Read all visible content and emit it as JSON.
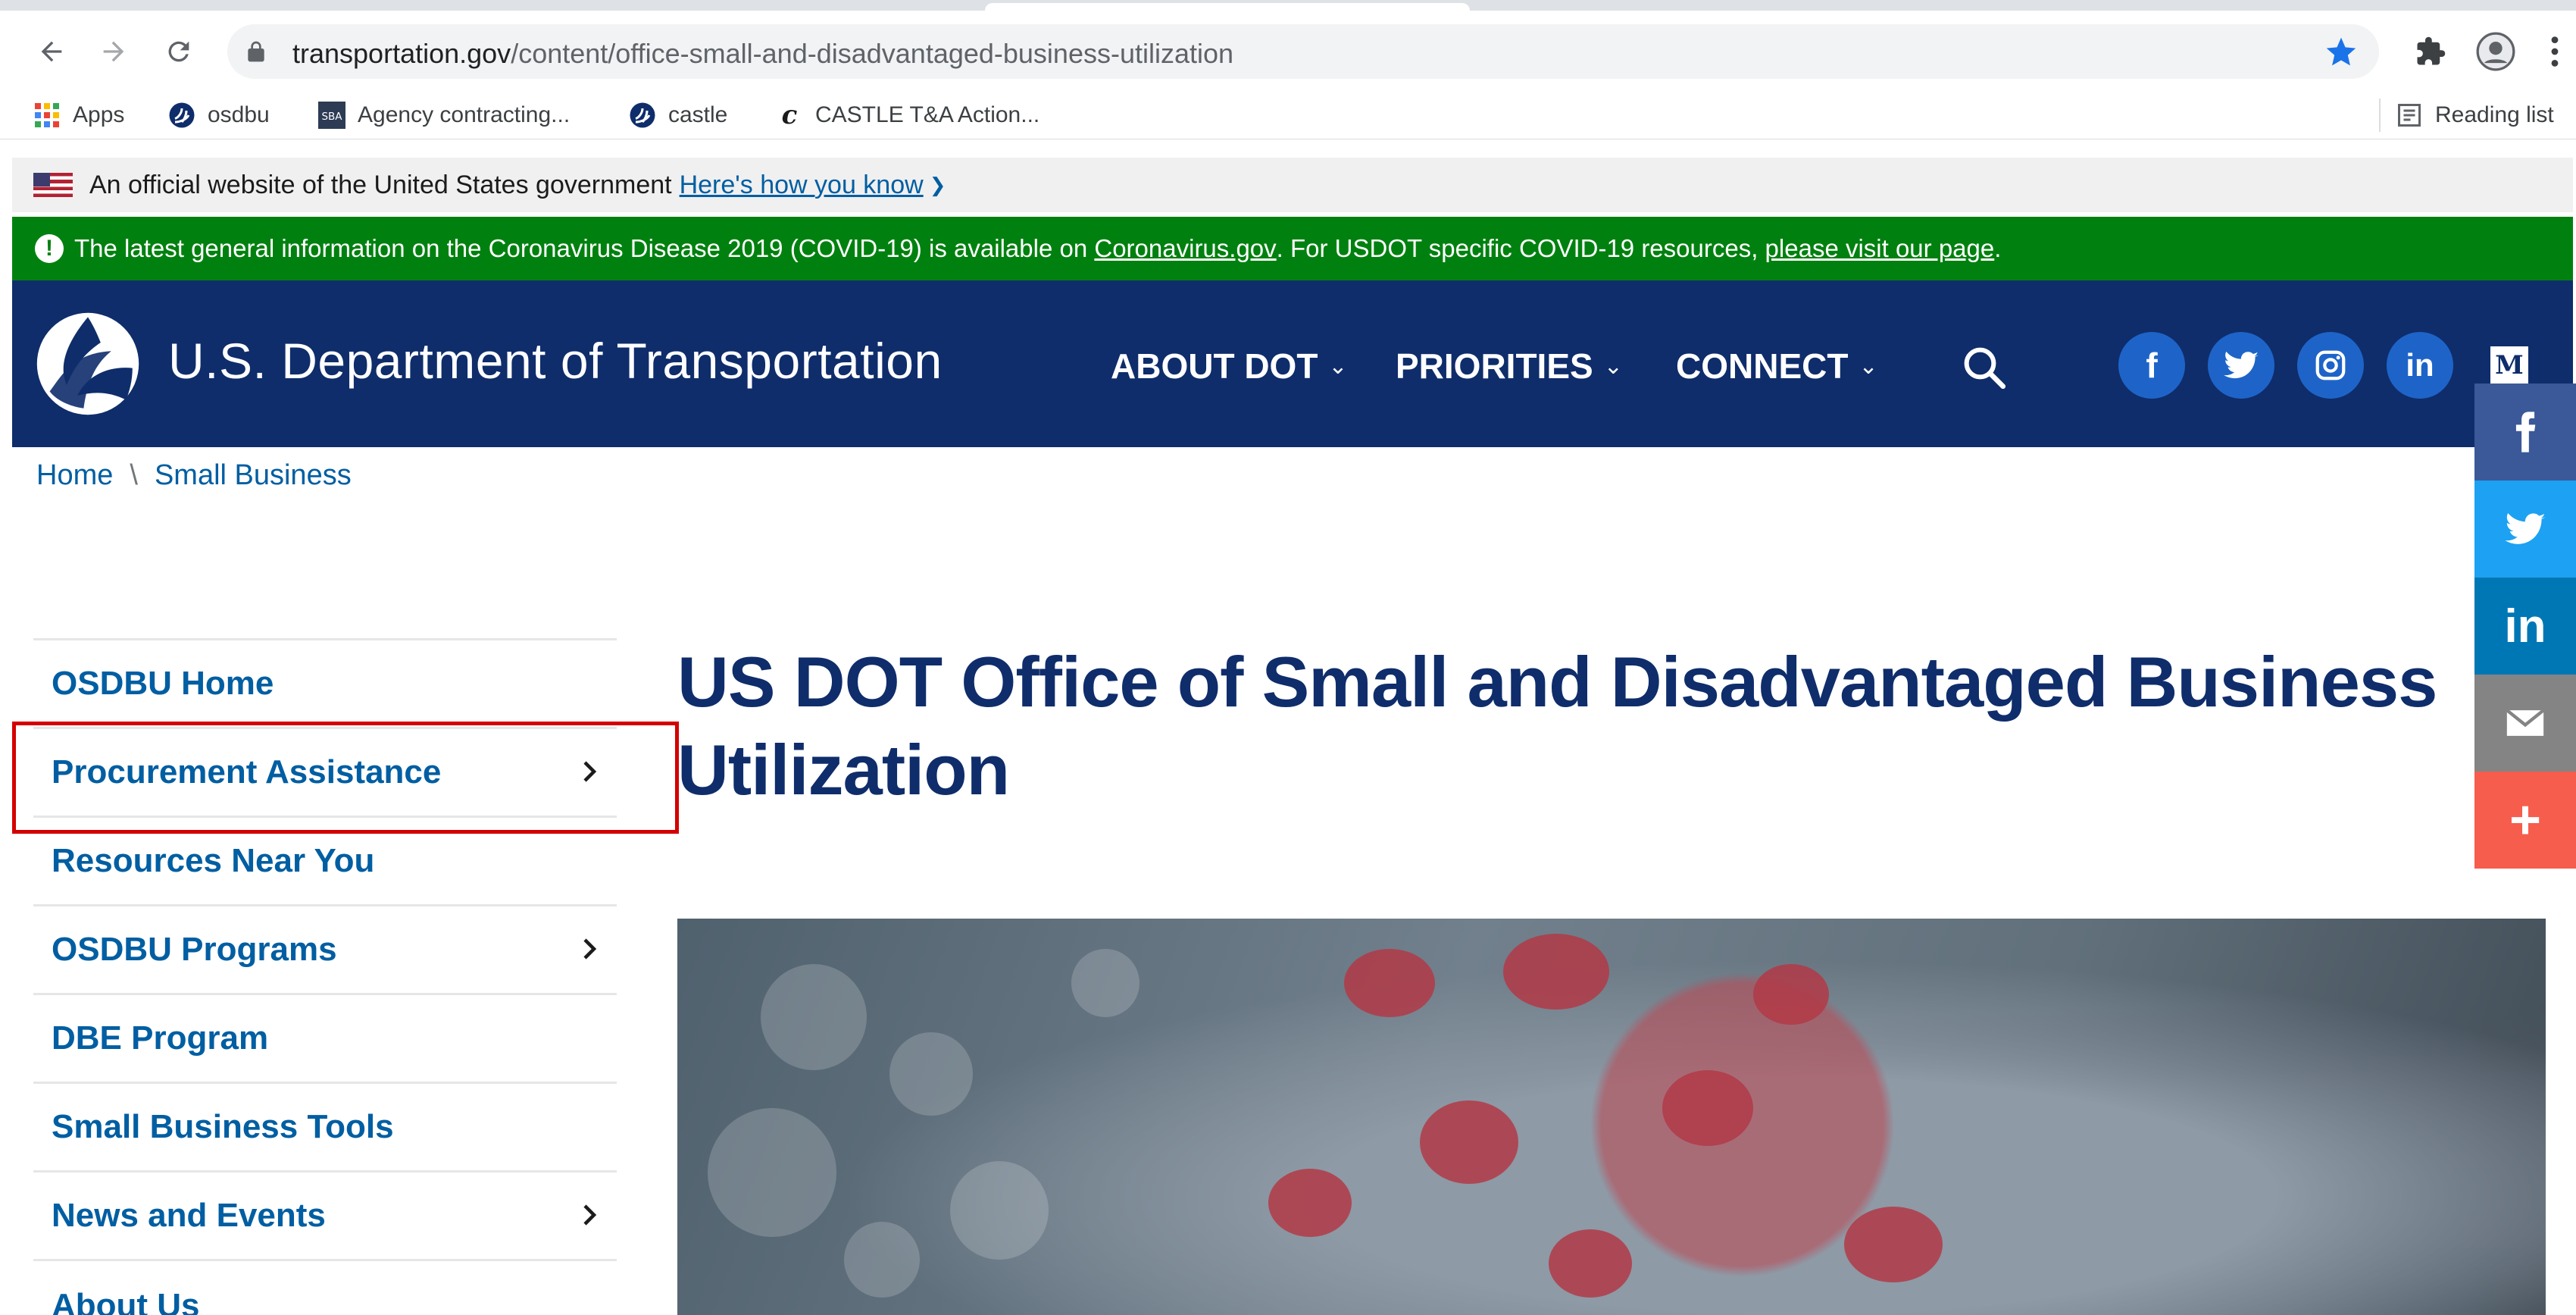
{
  "browser": {
    "url_host": "transportation.gov",
    "url_path": "/content/office-small-and-disadvantaged-business-utilization",
    "bookmarks": [
      {
        "label": "Apps",
        "icon": "apps-grid-icon"
      },
      {
        "label": "osdbu",
        "icon": "dot-logo-icon"
      },
      {
        "label": "Agency contracting...",
        "icon": "sba-icon"
      },
      {
        "label": "castle",
        "icon": "dot-logo-icon"
      },
      {
        "label": "CASTLE T&A Action...",
        "icon": "castle-c-icon"
      }
    ],
    "reading_list": "Reading list"
  },
  "gov_banner": {
    "text": "An official website of the United States government",
    "link": "Here's how you know"
  },
  "alert": {
    "text_1": "The latest general information on the Coronavirus Disease 2019 (COVID-19) is available on",
    "link_1": "Coronavirus.gov",
    "text_2": ". For USDOT specific COVID-19 resources,",
    "link_2": "please visit our page",
    "text_3": "."
  },
  "header": {
    "site_name": "U.S. Department of Transportation",
    "nav": [
      "ABOUT DOT",
      "PRIORITIES",
      "CONNECT"
    ],
    "social": {
      "facebook": "f",
      "twitter": "twitter-bird-icon",
      "instagram": "instagram-icon",
      "linkedin": "in",
      "medium": "M"
    }
  },
  "share_bar": {
    "colors": {
      "facebook": "#3b5998",
      "twitter": "#1da1f2",
      "linkedin": "#0077b5",
      "email": "#848484",
      "more": "#f65d4d"
    },
    "linkedin_label": "in",
    "more_label": "+"
  },
  "breadcrumb": [
    "Home",
    "Small Business"
  ],
  "sidenav": {
    "items": [
      {
        "label": "OSDBU Home",
        "has_submenu": false
      },
      {
        "label": "Procurement Assistance",
        "has_submenu": true
      },
      {
        "label": "Resources Near You",
        "has_submenu": false
      },
      {
        "label": "OSDBU Programs",
        "has_submenu": true
      },
      {
        "label": "DBE Program",
        "has_submenu": false
      },
      {
        "label": "Small Business Tools",
        "has_submenu": false
      },
      {
        "label": "News and Events",
        "has_submenu": true
      },
      {
        "label": "About Us",
        "has_submenu": false
      }
    ]
  },
  "main": {
    "title": "US DOT Office of Small and Disadvantaged Business Utilization"
  },
  "colors": {
    "header_navy": "#0f2d6b",
    "alert_green": "#00810f",
    "link_blue": "#005ea2",
    "highlight_red": "#d40000",
    "social_blue": "#1e64c8"
  }
}
